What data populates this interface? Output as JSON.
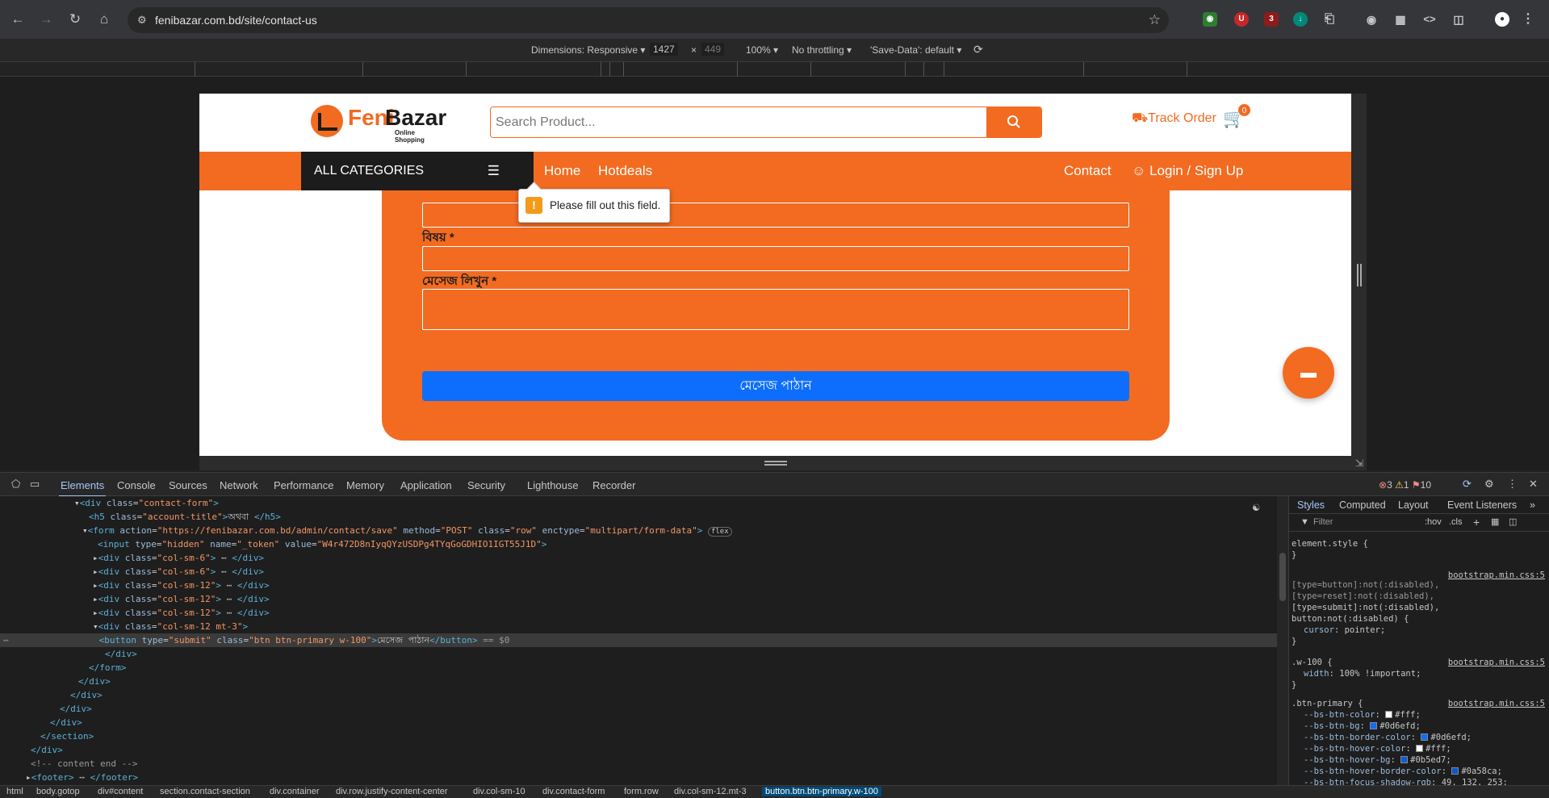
{
  "browser": {
    "url": "fenibazar.com.bd/site/contact-us",
    "ext_badge_count": "3"
  },
  "device_toolbar": {
    "dimensions_label": "Dimensions: Responsive",
    "width": "1427",
    "times": "×",
    "height": "449",
    "zoom": "100%",
    "throttling": "No throttling",
    "save_data": "'Save-Data': default"
  },
  "site": {
    "brand_part1": "Feni",
    "brand_part2": "Bazar",
    "tagline": "Online Shopping",
    "search_placeholder": "Search Product...",
    "track_order": "Track Order",
    "cart_count": "0",
    "all_categories": "ALL CATEGORIES",
    "nav": {
      "home": "Home",
      "hotdeals": "Hotdeals",
      "contact": "Contact",
      "login": "Login / Sign Up"
    },
    "form": {
      "subject_label": "বিষয় *",
      "message_label": "মেসেজ লিখুন *",
      "submit_label": "মেসেজ পাঠান"
    },
    "validation_message": "Please fill out this field.",
    "colors": {
      "brand": "#f26b21",
      "primary": "#0d6efd"
    }
  },
  "devtools": {
    "tabs": [
      "Elements",
      "Console",
      "Sources",
      "Network",
      "Performance",
      "Memory",
      "Application",
      "Security",
      "Lighthouse",
      "Recorder"
    ],
    "errors": "3",
    "warnings": "1",
    "issues": "10",
    "styles_tabs": [
      "Styles",
      "Computed",
      "Layout",
      "Event Listeners"
    ],
    "filter_placeholder": "Filter",
    "hov": ":hov",
    "cls": ".cls",
    "breadcrumbs": [
      "html",
      "body.gotop",
      "div#content",
      "section.contact-section",
      "div.container",
      "div.row.justify-content-center",
      "div.col-sm-10",
      "div.contact-form",
      "form.row",
      "div.col-sm-12.mt-3",
      "button.btn.btn-primary.w-100"
    ]
  }
}
